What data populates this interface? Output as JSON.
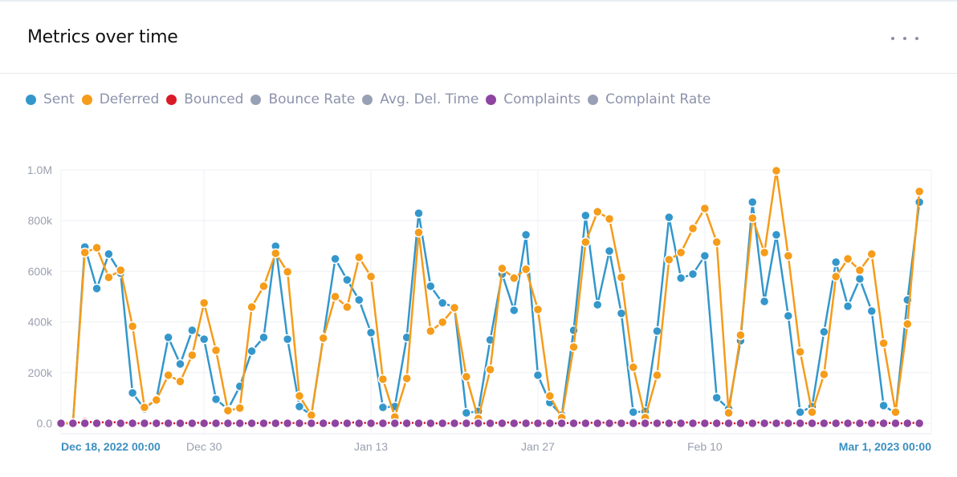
{
  "header": {
    "title": "Metrics over time",
    "more_icon": "more-horizontal-icon"
  },
  "legend": [
    {
      "label": "Sent",
      "color": "#3397cc"
    },
    {
      "label": "Deferred",
      "color": "#f59c1a"
    },
    {
      "label": "Bounced",
      "color": "#d81b27"
    },
    {
      "label": "Bounce Rate",
      "color": "#97a0b4"
    },
    {
      "label": "Avg. Del. Time",
      "color": "#97a0b4"
    },
    {
      "label": "Complaints",
      "color": "#8e44a0"
    },
    {
      "label": "Complaint Rate",
      "color": "#97a0b4"
    }
  ],
  "chart_data": {
    "type": "line",
    "title": "Metrics over time",
    "xlabel": "",
    "ylabel": "",
    "x_start": "Dec 18, 2022 00:00",
    "x_end": "Mar 1, 2023 00:00",
    "x_interval": "1 day",
    "x_ticks": [
      "Dec 18, 2022 00:00",
      "Dec 30",
      "Jan 13",
      "Jan 27",
      "Feb 10",
      "Mar 1, 2023 00:00"
    ],
    "x_tick_day_offsets": [
      0,
      12,
      26,
      40,
      54,
      73
    ],
    "y_ticks": [
      "0.0",
      "200k",
      "400k",
      "600k",
      "800k",
      "1.0M"
    ],
    "ylim": [
      0,
      1000000
    ],
    "grid": true,
    "legend_position": "top-left",
    "series": [
      {
        "name": "Sent",
        "color": "#3397cc",
        "values": [
          0,
          0,
          696000,
          532000,
          668000,
          592000,
          120000,
          57000,
          95000,
          339000,
          234000,
          367000,
          332000,
          95000,
          55000,
          146000,
          285000,
          339000,
          699000,
          332000,
          66000,
          32000,
          339000,
          649000,
          566000,
          487000,
          358000,
          63000,
          66000,
          339000,
          829000,
          541000,
          475000,
          459000,
          41000,
          47000,
          329000,
          589000,
          446000,
          744000,
          190000,
          82000,
          32000,
          367000,
          820000,
          468000,
          680000,
          434000,
          44000,
          47000,
          364000,
          813000,
          573000,
          589000,
          661000,
          101000,
          57000,
          326000,
          873000,
          481000,
          744000,
          424000,
          44000,
          66000,
          361000,
          636000,
          462000,
          570000,
          443000,
          70000,
          40000,
          487000,
          873000
        ]
      },
      {
        "name": "Deferred",
        "color": "#f59c1a",
        "values": [
          0,
          0,
          674000,
          693000,
          576000,
          604000,
          383000,
          63000,
          92000,
          190000,
          165000,
          269000,
          475000,
          288000,
          50000,
          60000,
          459000,
          541000,
          671000,
          598000,
          108000,
          32000,
          336000,
          500000,
          459000,
          655000,
          579000,
          174000,
          25000,
          177000,
          753000,
          364000,
          399000,
          456000,
          184000,
          19000,
          212000,
          611000,
          573000,
          608000,
          449000,
          108000,
          22000,
          301000,
          715000,
          835000,
          807000,
          576000,
          221000,
          22000,
          190000,
          646000,
          674000,
          769000,
          848000,
          715000,
          41000,
          348000,
          810000,
          674000,
          997000,
          661000,
          282000,
          44000,
          193000,
          579000,
          649000,
          604000,
          668000,
          316000,
          44000,
          392000,
          915000
        ]
      },
      {
        "name": "Bounced",
        "color": "#d81b27",
        "values": [
          0,
          0,
          6000,
          4000,
          4000,
          4000,
          0,
          0,
          0,
          0,
          0,
          2000,
          2000,
          0,
          0,
          0,
          0,
          2000,
          2000,
          2000,
          0,
          0,
          2000,
          0,
          3000,
          3000,
          0,
          0,
          3000,
          0,
          3000,
          0,
          0,
          0,
          0,
          0,
          0,
          3000,
          3000,
          3000,
          0,
          0,
          0,
          2000,
          2000,
          2000,
          3000,
          2000,
          0,
          0,
          3000,
          3000,
          3000,
          3000,
          2000,
          0,
          0,
          0,
          3000,
          3000,
          3000,
          0,
          0,
          0,
          0,
          4000,
          2000,
          2000,
          3000,
          2000,
          0,
          0,
          3000
        ]
      },
      {
        "name": "Bounce Rate",
        "color": "#97a0b4",
        "values": []
      },
      {
        "name": "Avg. Del. Time",
        "color": "#97a0b4",
        "values": []
      },
      {
        "name": "Complaints",
        "color": "#8e44a0",
        "values": [
          0,
          0,
          0,
          0,
          0,
          0,
          0,
          0,
          0,
          0,
          0,
          0,
          0,
          0,
          0,
          0,
          0,
          0,
          0,
          0,
          0,
          0,
          0,
          0,
          0,
          0,
          0,
          0,
          0,
          0,
          0,
          0,
          0,
          0,
          0,
          0,
          0,
          0,
          0,
          0,
          0,
          0,
          0,
          0,
          0,
          0,
          0,
          0,
          0,
          0,
          0,
          0,
          0,
          0,
          0,
          0,
          0,
          0,
          0,
          0,
          0,
          0,
          0,
          0,
          0,
          0,
          0,
          0,
          0,
          0,
          0,
          0,
          0
        ]
      },
      {
        "name": "Complaint Rate",
        "color": "#97a0b4",
        "values": []
      }
    ]
  }
}
